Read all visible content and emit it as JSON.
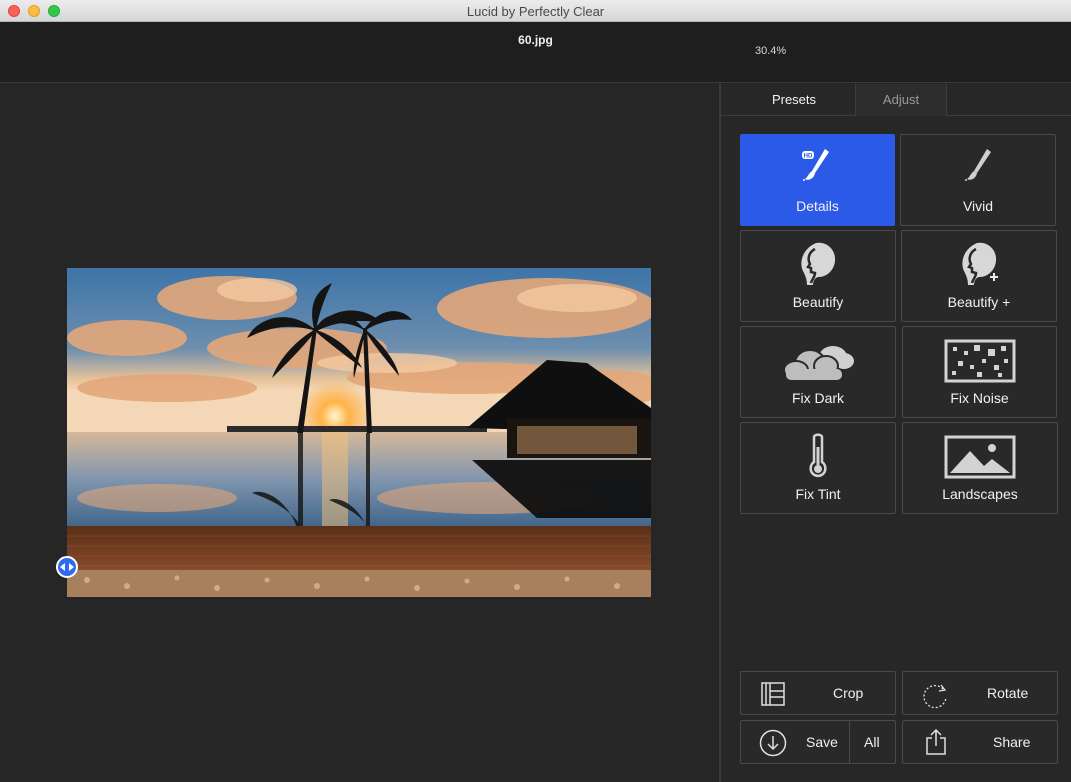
{
  "window": {
    "title": "Lucid by Perfectly Clear"
  },
  "info": {
    "filename": "60.jpg",
    "zoom": "30.4%"
  },
  "tabs": {
    "presets": "Presets",
    "adjust": "Adjust"
  },
  "presets": [
    {
      "label": "Details",
      "icon": "hd-brush-icon",
      "active": true
    },
    {
      "label": "Vivid",
      "icon": "brush-icon",
      "active": false
    },
    {
      "label": "Beautify",
      "icon": "face-profile-icon",
      "active": false
    },
    {
      "label": "Beautify +",
      "icon": "face-profile-plus-icon",
      "active": false
    },
    {
      "label": "Fix Dark",
      "icon": "clouds-icon",
      "active": false
    },
    {
      "label": "Fix Noise",
      "icon": "noise-icon",
      "active": false
    },
    {
      "label": "Fix Tint",
      "icon": "thermometer-icon",
      "active": false
    },
    {
      "label": "Landscapes",
      "icon": "landscape-icon",
      "active": false
    }
  ],
  "actions": {
    "crop": "Crop",
    "rotate": "Rotate",
    "save": "Save",
    "save_all": "All",
    "share": "Share"
  },
  "colors": {
    "accent": "#2c5ae8",
    "panel": "#272727",
    "canvas": "#262626"
  }
}
